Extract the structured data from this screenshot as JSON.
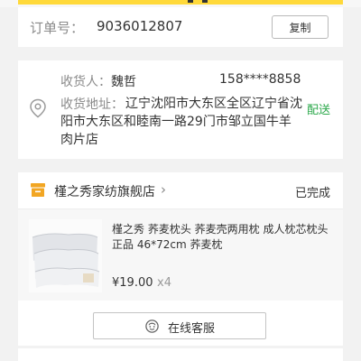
{
  "order": {
    "label": "订单号：",
    "number": "9036012807",
    "copy_label": "复制"
  },
  "address": {
    "receiver_label": "收货人：",
    "receiver_name": "魏哲",
    "phone": "158****8858",
    "address_label": "收货地址：",
    "address_text": "辽宁沈阳市大东区全区辽宁省沈阳市大东区和睦南一路29门市邹立国牛羊肉片店",
    "delivery_mode": "配送"
  },
  "store": {
    "name": "槿之秀家纺旗舰店",
    "status": "已完成"
  },
  "product": {
    "title": "槿之秀 荞麦枕头 荞麦壳两用枕 成人枕芯枕头 正品 46*72cm 荞麦枕",
    "price": "¥19.00",
    "quantity": "x4"
  },
  "actions": {
    "service_label": "在线客服"
  },
  "colors": {
    "accent_yellow": "#ffd93a",
    "delivery_green": "#2aa84a",
    "store_icon_orange": "#f2a623"
  }
}
